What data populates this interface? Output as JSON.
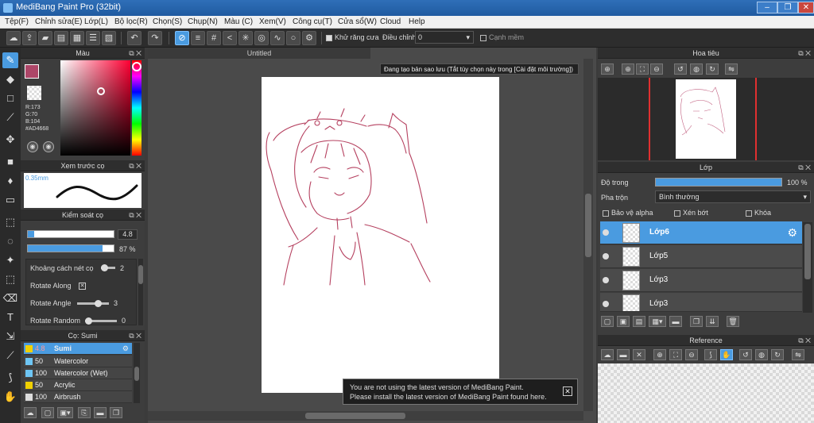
{
  "window": {
    "title": "MediBang Paint Pro (32bit)"
  },
  "menu": [
    "Tệp(F)",
    "Chỉnh sửa(E)",
    "Lớp(L)",
    "Bộ lọc(R)",
    "Chọn(S)",
    "Chụp(N)",
    "Màu (C)",
    "Xem(V)",
    "Công cụ(T)",
    "Cửa sổ(W)",
    "Cloud",
    "Help"
  ],
  "toolbar": {
    "antialias_label": "Khử răng cưa",
    "adjust_label": "Điều chỉnh",
    "adjust_value": "0",
    "sharp_edge_label": "Cạnh mềm"
  },
  "canvas": {
    "tab_title": "Untitled",
    "save_message": "Đang tạo bản sao lưu (Tắt tùy chọn này trong [Cài đặt môi trường])",
    "update_line1": "You are not using the latest version of MediBang Paint.",
    "update_line2": "Please install the latest version of MediBang Paint found here."
  },
  "color_panel": {
    "title": "Màu",
    "r": "R:173",
    "g": "G:70",
    "b": "B:104",
    "hex": "#AD4668",
    "current_color": "#AD4668"
  },
  "brush_preview": {
    "title": "Xem trước cọ",
    "size_label": "0.35mm"
  },
  "brush_control": {
    "title": "Kiểm soát cọ",
    "size_value": "4.8",
    "opacity_value": "87 %",
    "opacity_fraction": 0.87,
    "spacing_label": "Khoảng cách nét cọ",
    "spacing_value": "2",
    "rotate_along_label": "Rotate Along",
    "rotate_angle_label": "Rotate Angle",
    "rotate_angle_value": "3",
    "rotate_random_label": "Rotate Random",
    "rotate_random_value": "0"
  },
  "brush_list": {
    "title": "Cọ: Sumi",
    "items": [
      {
        "size": "4.8",
        "name": "Sumi",
        "color": "#f0d000"
      },
      {
        "size": "50",
        "name": "Watercolor",
        "color": "#6ec6f5"
      },
      {
        "size": "100",
        "name": "Watercolor (Wet)",
        "color": "#6ec6f5"
      },
      {
        "size": "50",
        "name": "Acrylic",
        "color": "#f0d000"
      },
      {
        "size": "100",
        "name": "Airbrush",
        "color": "#dddddd"
      }
    ]
  },
  "navigator": {
    "title": "Hoa tiêu"
  },
  "layer_panel": {
    "title": "Lớp",
    "opacity_label": "Độ trong",
    "opacity_value": "100 %",
    "blend_label": "Pha trộn",
    "blend_value": "Bình thường",
    "protect_alpha": "Bảo vệ alpha",
    "clip": "Xén bớt",
    "lock": "Khóa",
    "layers": [
      {
        "name": "Lớp6"
      },
      {
        "name": "Lớp5"
      },
      {
        "name": "Lớp3"
      },
      {
        "name": "Lớp3"
      }
    ]
  },
  "reference": {
    "title": "Reference"
  }
}
